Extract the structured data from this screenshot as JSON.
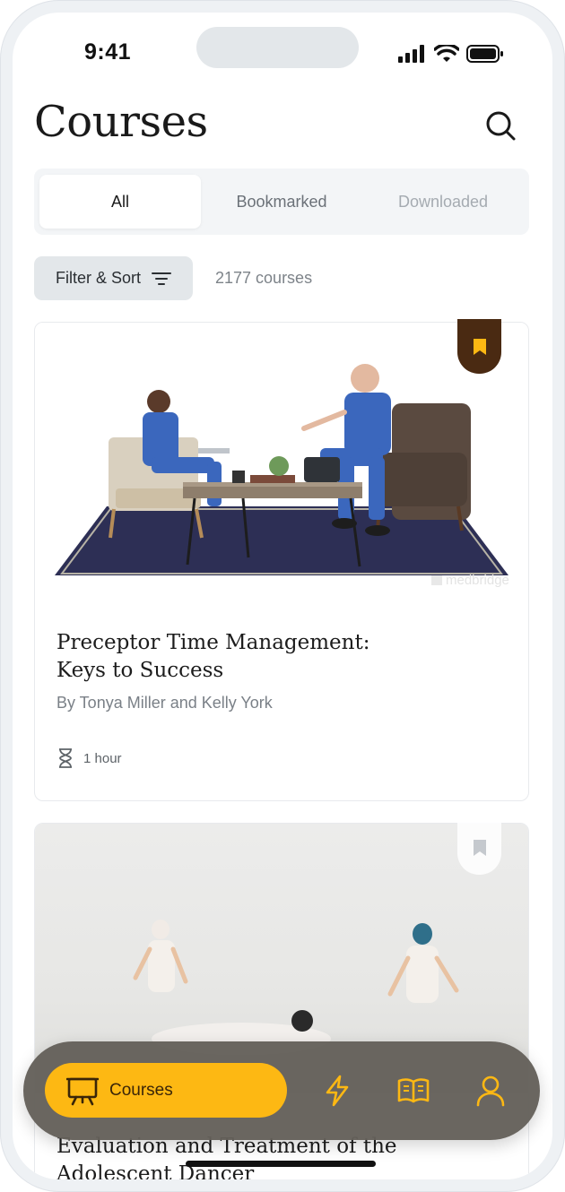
{
  "status_bar": {
    "time": "9:41"
  },
  "header": {
    "title": "Courses"
  },
  "tabs": [
    {
      "label": "All",
      "state": "active"
    },
    {
      "label": "Bookmarked",
      "state": "normal"
    },
    {
      "label": "Downloaded",
      "state": "faint"
    }
  ],
  "filter": {
    "label": "Filter & Sort",
    "count": "2177 courses"
  },
  "courses": [
    {
      "title_line1": "Preceptor Time Management:",
      "title_line2": "Keys to Success",
      "author": "By Tonya Miller and Kelly York",
      "duration": "1 hour",
      "bookmarked": true,
      "image": "medbridge-watermark",
      "watermark": "medbridge"
    },
    {
      "title_line1": "Evaluation and Treatment of the",
      "title_line2": "Adolescent Dancer",
      "bookmarked": false
    }
  ],
  "bottom_nav": {
    "items": [
      {
        "label": "Courses",
        "icon": "presentation-board-icon",
        "active": true
      },
      {
        "label": "",
        "icon": "lightning-icon",
        "active": false
      },
      {
        "label": "",
        "icon": "open-book-icon",
        "active": false
      },
      {
        "label": "",
        "icon": "user-icon",
        "active": false
      }
    ]
  },
  "colors": {
    "accent": "#fdb813",
    "bookmark_active": "#4a2a12",
    "nav_bg": "#64605a"
  }
}
